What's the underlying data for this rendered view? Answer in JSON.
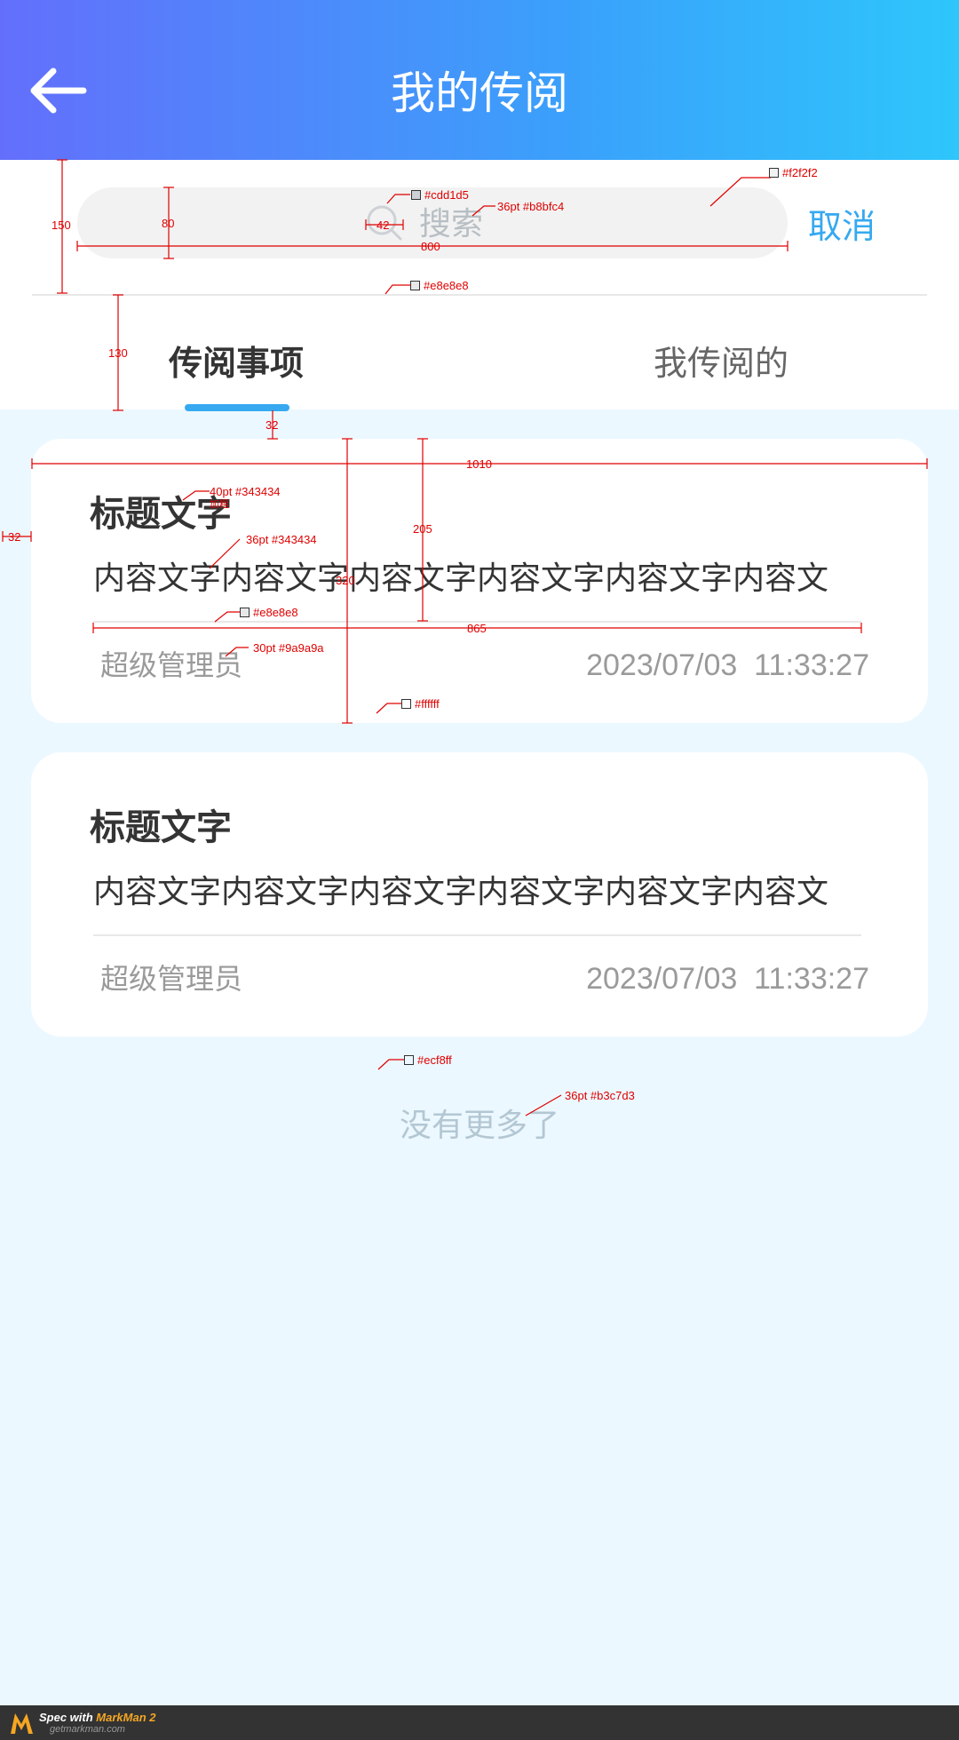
{
  "header": {
    "title": "我的传阅",
    "back_icon": "arrow-left-icon",
    "bg_gradient": [
      "#636ffb",
      "#2ec6fb"
    ]
  },
  "search": {
    "placeholder": "搜索",
    "icon": "search-icon",
    "cancel_label": "取消",
    "bg_color": "#f2f2f2"
  },
  "tabs": [
    {
      "label": "传阅事项",
      "active": true
    },
    {
      "label": "我传阅的",
      "active": false
    }
  ],
  "cards": [
    {
      "title": "标题文字",
      "content": "内容文字内容文字内容文字内容文字内容文字内容文",
      "author": "超级管理员",
      "time": "2023/07/03  11:33:27"
    },
    {
      "title": "标题文字",
      "content": "内容文字内容文字内容文字内容文字内容文字内容文",
      "author": "超级管理员",
      "time": "2023/07/03  11:33:27"
    }
  ],
  "no_more": "没有更多了",
  "annotations": {
    "search_height_outer": "150",
    "search_height_inner": "80",
    "search_icon_size": "42",
    "search_width": "800",
    "tab_height": "130",
    "tab_gap": "32",
    "card_width": "1010",
    "card_margin": "32",
    "card_text_height": "205",
    "card_height": "320",
    "divider_width": "865",
    "color_search_bg": "#f2f2f2",
    "color_icon": "#cdd1d5",
    "spec_placeholder": "36pt #b8bfc4",
    "color_divider": "#e8e8e8",
    "spec_title": "40pt #343434",
    "spec_bold": "加粗",
    "spec_content": "36pt #343434",
    "color_card_divider": "#e8e8e8",
    "spec_meta": "30pt #9a9a9a",
    "color_card_bg": "#ffffff",
    "color_page_bg": "#ecf8ff",
    "spec_nomore": "36pt #b3c7d3"
  },
  "footer": {
    "brand_prefix": "Spec with ",
    "brand_name": "MarkMan 2",
    "url": "getmarkman.com"
  }
}
